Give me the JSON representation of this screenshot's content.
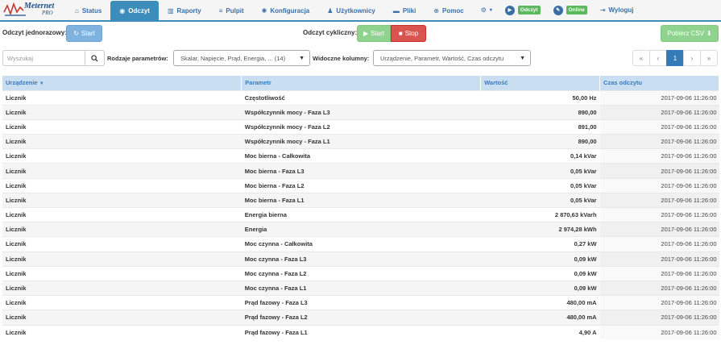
{
  "logo": {
    "text_main": "Meternet",
    "text_sub": "PRO"
  },
  "nav": [
    {
      "label": "Status",
      "icon": "home-icon"
    },
    {
      "label": "Odczyt",
      "icon": "eye-icon",
      "active": true
    },
    {
      "label": "Raporty",
      "icon": "bar-chart-icon"
    },
    {
      "label": "Pulpit",
      "icon": "list-icon"
    },
    {
      "label": "Konfiguracja",
      "icon": "gear-icon"
    },
    {
      "label": "Użytkownicy",
      "icon": "user-icon"
    },
    {
      "label": "Pliki",
      "icon": "folder-icon"
    },
    {
      "label": "Pomoc",
      "icon": "help-icon"
    }
  ],
  "nav_status": {
    "odczyt_badge": "Odczyt",
    "online_badge": "Online",
    "logout_label": "Wyloguj"
  },
  "toolbar": {
    "single_read_label": "Odczyt jednorazowy:",
    "single_start_label": "Start",
    "cyclic_read_label": "Odczyt cykliczny:",
    "cyclic_start_label": "Start",
    "cyclic_stop_label": "Stop",
    "csv_label": "Pobierz CSV"
  },
  "filters": {
    "search_placeholder": "Wyszukaj",
    "param_types_label": "Rodzaje parametrów:",
    "param_types_value": "Skalar, Napięcie, Prąd, Energia, ... (14)",
    "visible_columns_label": "Widoczne kolumny:",
    "visible_columns_value": "Urządzenie, Parametr, Wartość, Czas odczytu"
  },
  "pagination": {
    "first": "«",
    "prev": "‹",
    "current": "1",
    "next": "›",
    "last": "»"
  },
  "table": {
    "headers": [
      "Urządzenie",
      "Parametr",
      "Wartość",
      "Czas odczytu"
    ],
    "rows": [
      [
        "Licznik",
        "Częstotliwość",
        "50,00 Hz",
        "2017-09-06 11:26:00"
      ],
      [
        "Licznik",
        "Współczynnik mocy - Faza L3",
        "890,00",
        "2017-09-06 11:26:00"
      ],
      [
        "Licznik",
        "Współczynnik mocy - Faza L2",
        "891,00",
        "2017-09-06 11:26:00"
      ],
      [
        "Licznik",
        "Współczynnik mocy - Faza L1",
        "890,00",
        "2017-09-06 11:26:00"
      ],
      [
        "Licznik",
        "Moc bierna - Całkowita",
        "0,14 kVar",
        "2017-09-06 11:26:00"
      ],
      [
        "Licznik",
        "Moc bierna - Faza L3",
        "0,05 kVar",
        "2017-09-06 11:26:00"
      ],
      [
        "Licznik",
        "Moc bierna - Faza L2",
        "0,05 kVar",
        "2017-09-06 11:26:00"
      ],
      [
        "Licznik",
        "Moc bierna - Faza L1",
        "0,05 kVar",
        "2017-09-06 11:26:00"
      ],
      [
        "Licznik",
        "Energia bierna",
        "2 870,63 kVarh",
        "2017-09-06 11:26:00"
      ],
      [
        "Licznik",
        "Energia",
        "2 974,28 kWh",
        "2017-09-06 11:26:00"
      ],
      [
        "Licznik",
        "Moc czynna - Całkowita",
        "0,27 kW",
        "2017-09-06 11:26:00"
      ],
      [
        "Licznik",
        "Moc czynna - Faza L3",
        "0,09 kW",
        "2017-09-06 11:26:00"
      ],
      [
        "Licznik",
        "Moc czynna - Faza L2",
        "0,09 kW",
        "2017-09-06 11:26:00"
      ],
      [
        "Licznik",
        "Moc czynna - Faza L1",
        "0,09 kW",
        "2017-09-06 11:26:00"
      ],
      [
        "Licznik",
        "Prąd fazowy - Faza L3",
        "480,00 mA",
        "2017-09-06 11:26:00"
      ],
      [
        "Licznik",
        "Prąd fazowy - Faza L2",
        "480,00 mA",
        "2017-09-06 11:26:00"
      ],
      [
        "Licznik",
        "Prąd fazowy - Faza L1",
        "4,90 A",
        "2017-09-06 11:26:00"
      ]
    ]
  },
  "colors": {
    "accent": "#3c8dbc",
    "header_bg": "#c9def0",
    "green_badge": "#5cb85c",
    "stop_red": "#d9534f"
  }
}
